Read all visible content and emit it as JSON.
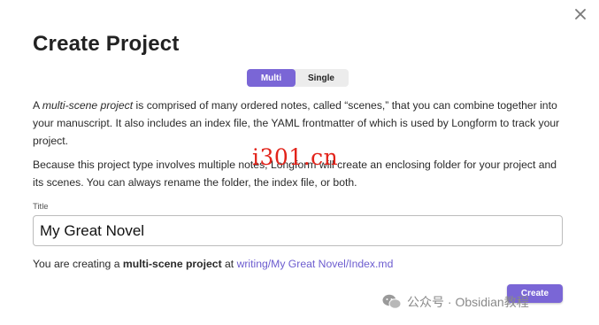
{
  "dialog": {
    "title": "Create Project",
    "close_icon": "close-icon"
  },
  "mode_toggle": {
    "options": [
      {
        "label": "Multi",
        "selected": true
      },
      {
        "label": "Single",
        "selected": false
      }
    ],
    "accent_color": "#7a66d6"
  },
  "description": {
    "p1_prefix": "A ",
    "p1_em": "multi-scene project",
    "p1_rest": " is comprised of many ordered notes, called “scenes,” that you can combine together into your manuscript. It also includes an index file, the YAML frontmatter of which is used by Longform to track your project.",
    "p2": "Because this project type involves multiple notes, Longform will create an enclosing folder for your project and its scenes. You can always rename the folder, the index file, or both."
  },
  "title_field": {
    "label": "Title",
    "value": "My Great Novel"
  },
  "summary": {
    "prefix": "You are creating a ",
    "bold": "multi-scene project",
    "middle": " at ",
    "path": "writing/My Great Novel/Index.md"
  },
  "actions": {
    "create_label": "Create"
  },
  "watermarks": {
    "overlay_text": "i301.cn",
    "brand_text": "公众号 · Obsidian教程",
    "brand_icon": "wechat-icon"
  }
}
